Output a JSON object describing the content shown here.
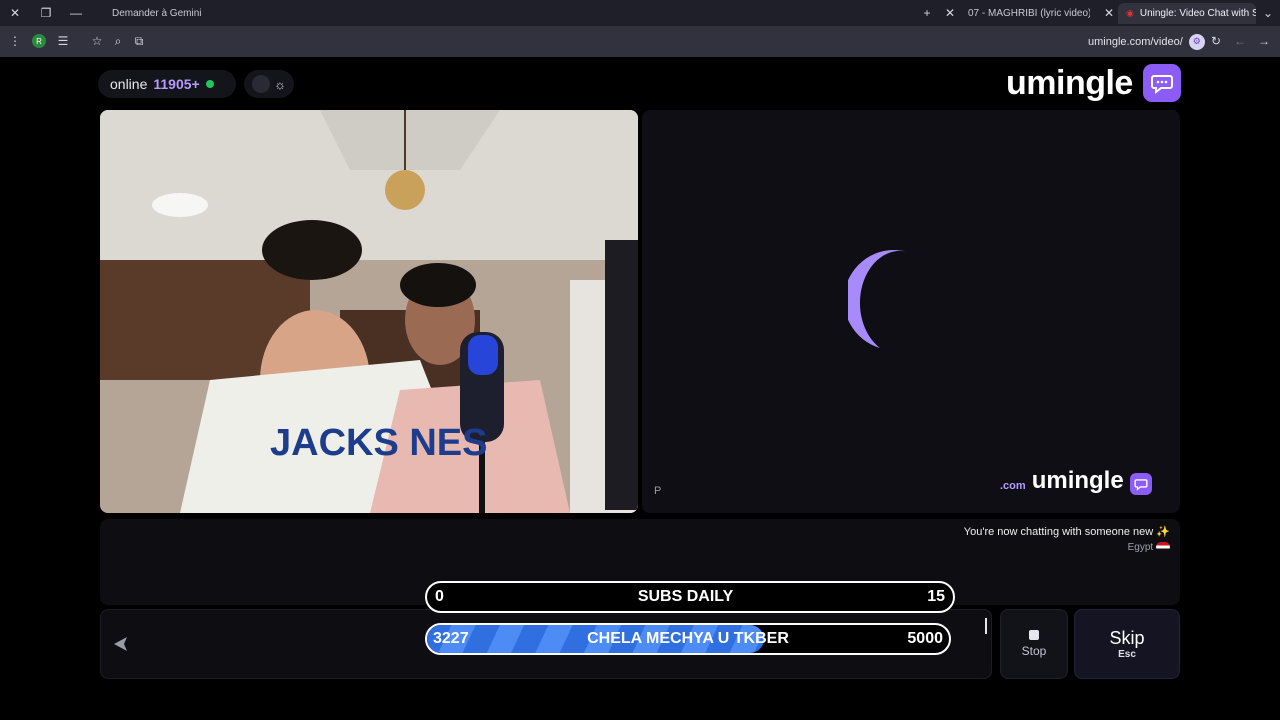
{
  "browser": {
    "tabs": [
      {
        "label": "Uningle: Video Chat with S",
        "active": true
      },
      {
        "label": "07 - MAGHRIBI (lyric video)",
        "active": false
      },
      {
        "label": "Demander à Gemini",
        "active": false
      }
    ],
    "url": "umingle.com/video/"
  },
  "header": {
    "logo_text": "umingle",
    "online_count": "11905+",
    "online_label": "online"
  },
  "video": {
    "watermark_text": "umingle",
    "watermark_suffix": ".com",
    "report_label": "P"
  },
  "chat": {
    "message": "You're now chatting with someone new",
    "message_emoji": "✨",
    "country": "Egypt"
  },
  "controls": {
    "stop_label": "Stop",
    "skip_label": "Skip",
    "skip_key": "Esc"
  },
  "overlay": {
    "subs": {
      "left": "0",
      "title": "SUBS DAILY",
      "right": "15"
    },
    "goal": {
      "current": "3227",
      "title": "CHELA MECHYA U TKBER",
      "target": "5000",
      "progress": 0.6454
    }
  },
  "colors": {
    "accent": "#8b5cf6",
    "online_dot": "#22c55e",
    "goal_fill": "#3b7bef"
  }
}
